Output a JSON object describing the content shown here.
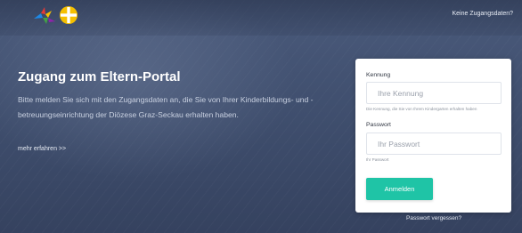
{
  "header": {
    "logo_icons": [
      "pinwheel-logo-icon",
      "cross-logo-icon"
    ],
    "no_credentials_link": "Keine Zugangsdaten?"
  },
  "intro": {
    "title": "Zugang zum Eltern-Portal",
    "text": "Bitte melden Sie sich mit den Zugangsdaten an, die Sie von Ihrer Kinderbildungs- und -betreuungseinrichtung der Diözese Graz-Seckau erhalten haben.",
    "more_link": "mehr erfahren >>"
  },
  "login": {
    "username_label": "Kennung",
    "username_placeholder": "Ihre Kennung",
    "username_help": "Die Kennung, die Sie von Ihrem Kindergarten erhalten haben",
    "password_label": "Passwort",
    "password_placeholder": "Ihr Passwort",
    "password_help": "Ihr Passwort",
    "submit_label": "Anmelden",
    "forgot_link": "Passwort vergessen?"
  },
  "colors": {
    "background": "#3f4e6c",
    "accent": "#1fc4a6",
    "logo_yellow": "#f6c000"
  }
}
